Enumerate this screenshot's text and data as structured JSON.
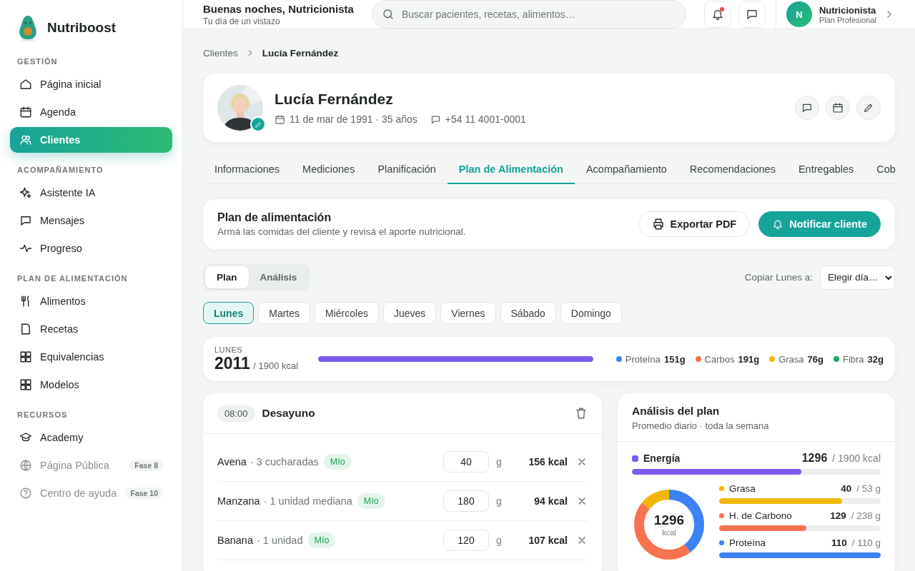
{
  "app": {
    "name": "Nutriboost"
  },
  "sidebar": {
    "sections": [
      {
        "title": "GESTIÓN",
        "items": [
          {
            "label": "Página inicial",
            "selected": false,
            "disabled": false
          },
          {
            "label": "Agenda",
            "selected": false,
            "disabled": false
          },
          {
            "label": "Clientes",
            "selected": true,
            "disabled": false
          }
        ]
      },
      {
        "title": "ACOMPAÑAMIENTO",
        "items": [
          {
            "label": "Asistente IA",
            "selected": false,
            "disabled": false
          },
          {
            "label": "Mensajes",
            "selected": false,
            "disabled": false
          },
          {
            "label": "Progreso",
            "selected": false,
            "disabled": false
          }
        ]
      },
      {
        "title": "PLAN DE ALIMENTACIÓN",
        "items": [
          {
            "label": "Alimentos",
            "selected": false,
            "disabled": false
          },
          {
            "label": "Recetas",
            "selected": false,
            "disabled": false
          },
          {
            "label": "Equivalencias",
            "selected": false,
            "disabled": false
          },
          {
            "label": "Modelos",
            "selected": false,
            "disabled": false
          }
        ]
      },
      {
        "title": "RECURSOS",
        "items": [
          {
            "label": "Academy",
            "selected": false,
            "disabled": false
          },
          {
            "label": "Página Pública",
            "selected": false,
            "disabled": true,
            "badge": "Fase 8"
          },
          {
            "label": "Centro de ayuda",
            "selected": false,
            "disabled": true,
            "badge": "Fase 10"
          }
        ]
      }
    ]
  },
  "topbar": {
    "greeting": "Buenas noches, Nutricionista",
    "subtitle": "Tu día de un vistazo",
    "search": {
      "placeholder": "Buscar pacientes, recetas, alimentos…"
    },
    "notifications_unread": true,
    "user": {
      "initial": "N",
      "name": "Nutricionista",
      "plan": "Plan Profesional"
    }
  },
  "breadcrumb": [
    "Clientes",
    "Lucía Fernández"
  ],
  "client": {
    "name": "Lucía Fernández",
    "birth": "11 de mar de 1991 · 35 años",
    "phone": "+54 11 4001-0001"
  },
  "tabs": [
    {
      "label": "Informaciones",
      "selected": false
    },
    {
      "label": "Mediciones",
      "selected": false
    },
    {
      "label": "Planificación",
      "selected": false
    },
    {
      "label": "Plan de Alimentación",
      "selected": true
    },
    {
      "label": "Acompañamiento",
      "selected": false
    },
    {
      "label": "Recomendaciones",
      "selected": false
    },
    {
      "label": "Entregables",
      "selected": false
    },
    {
      "label": "Cob",
      "selected": false
    }
  ],
  "plan_header": {
    "title": "Plan de alimentación",
    "subtitle": "Armá las comidas del cliente y revisá el aporte nutricional.",
    "buttons": [
      {
        "label": "Exportar PDF",
        "kind": "secondary"
      },
      {
        "label": "Notificar cliente",
        "kind": "primary"
      }
    ]
  },
  "view_toggle": [
    {
      "label": "Plan",
      "selected": true
    },
    {
      "label": "Análisis",
      "selected": false
    }
  ],
  "copy_day": {
    "label": "Copiar Lunes a:",
    "value": "Elegir día…"
  },
  "days": [
    {
      "label": "Lunes",
      "selected": true
    },
    {
      "label": "Martes",
      "selected": false
    },
    {
      "label": "Miércoles",
      "selected": false
    },
    {
      "label": "Jueves",
      "selected": false
    },
    {
      "label": "Viernes",
      "selected": false
    },
    {
      "label": "Sábado",
      "selected": false
    },
    {
      "label": "Domingo",
      "selected": false
    }
  ],
  "day_summary": {
    "day": "LUNES",
    "total": "2011",
    "target": "/ 1900 kcal",
    "level": 1,
    "macros": [
      {
        "name": "Proteína",
        "value": "151g",
        "color": "#3b82f6"
      },
      {
        "name": "Carbos",
        "value": "191g",
        "color": "#f97350"
      },
      {
        "name": "Grasa",
        "value": "76g",
        "color": "#f2b705"
      },
      {
        "name": "Fibra",
        "value": "32g",
        "color": "#22a565"
      }
    ]
  },
  "meal": {
    "time": "08:00",
    "name": "Desayuno",
    "foods": [
      {
        "name": "Avena",
        "portion": "· 3 cucharadas",
        "tag": "Mío",
        "amount": "40",
        "unit": "g",
        "kcal": "156 kcal"
      },
      {
        "name": "Manzana",
        "portion": "· 1 unidad mediana",
        "tag": "Mío",
        "amount": "180",
        "unit": "g",
        "kcal": "94 kcal"
      },
      {
        "name": "Banana",
        "portion": "· 1 unidad",
        "tag": "Mío",
        "amount": "120",
        "unit": "g",
        "kcal": "107 kcal"
      }
    ]
  },
  "analysis": {
    "title": "Análisis del plan",
    "subtitle": "Promedio diario · toda la semana",
    "energy": {
      "label": "Energía",
      "value": "1296",
      "target": "/ 1900 kcal",
      "level": 0.68,
      "color": "#7c5cf0"
    },
    "donut_total": "1296",
    "donut_unit": "kcal",
    "macros": [
      {
        "label": "Grasa",
        "value": "40",
        "target": "/ 53 g",
        "level": 0.76,
        "color": "#f2b705"
      },
      {
        "label": "H. de Carbono",
        "value": "129",
        "target": "/ 238 g",
        "level": 0.54,
        "color": "#f97350"
      },
      {
        "label": "Proteína",
        "value": "110",
        "target": "/ 110 g",
        "level": 1,
        "color": "#3b82f6"
      }
    ]
  }
}
